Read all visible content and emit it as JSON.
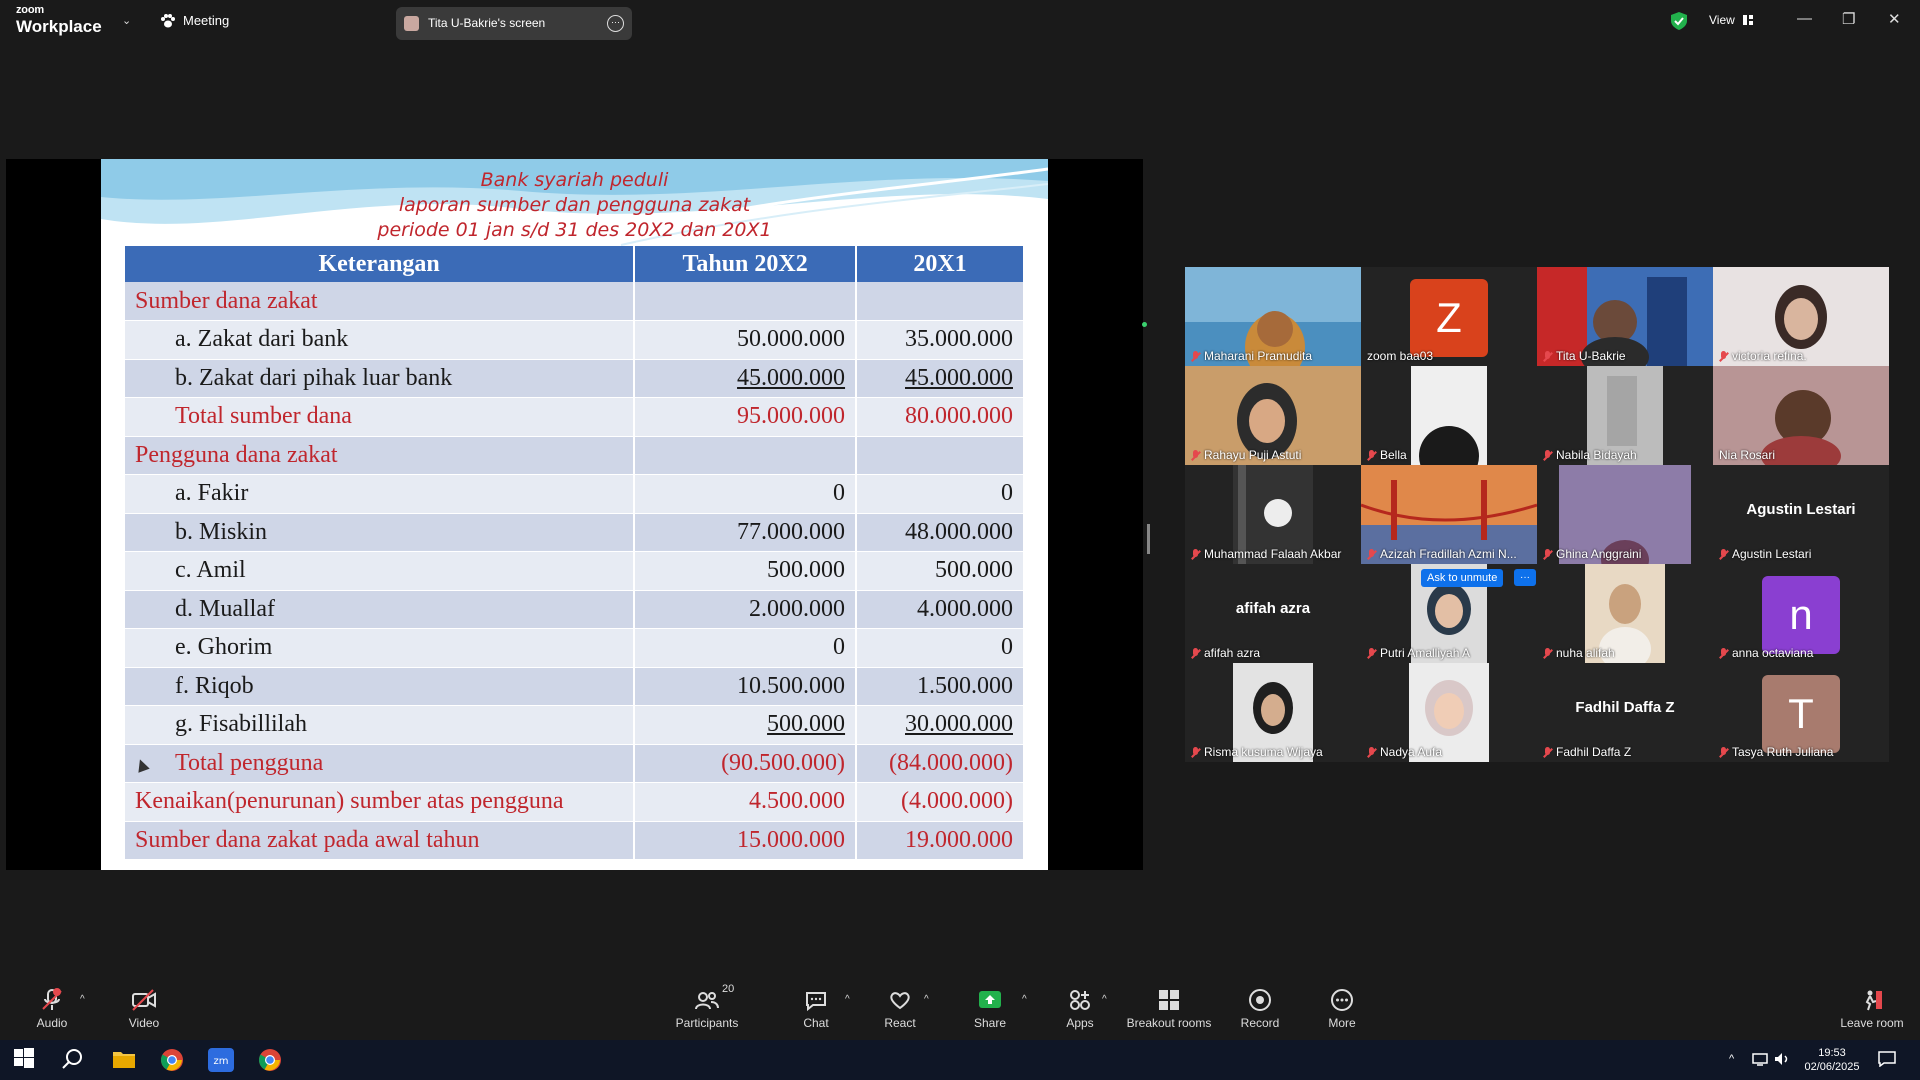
{
  "app": {
    "logo_line1": "zoom",
    "logo_line2": "Workplace",
    "meeting_label": "Meeting",
    "share_pill": "Tita U-Bakrie's screen",
    "view_label": "View"
  },
  "slide": {
    "title1": "Bank syariah peduli",
    "title2": "laporan sumber dan pengguna zakat",
    "title3": "periode 01 jan s/d 31 des 20X2 dan 20X1",
    "headers": [
      "Keterangan",
      "Tahun 20X2",
      "20X1"
    ],
    "rows": [
      {
        "label": "Sumber  dana zakat",
        "v1": "",
        "v2": ""
      },
      {
        "label": "a. Zakat dari bank",
        "v1": "50.000.000",
        "v2": "35.000.000"
      },
      {
        "label": "b. Zakat dari pihak luar bank",
        "v1": "45.000.000",
        "v2": "45.000.000"
      },
      {
        "label": "Total sumber dana",
        "v1": "95.000.000",
        "v2": "80.000.000"
      },
      {
        "label": "Pengguna dana zakat",
        "v1": "",
        "v2": ""
      },
      {
        "label": "a. Fakir",
        "v1": "0",
        "v2": "0"
      },
      {
        "label": "b. Miskin",
        "v1": "77.000.000",
        "v2": "48.000.000"
      },
      {
        "label": "c. Amil",
        "v1": "500.000",
        "v2": "500.000"
      },
      {
        "label": "d. Muallaf",
        "v1": "2.000.000",
        "v2": "4.000.000"
      },
      {
        "label": "e. Ghorim",
        "v1": "0",
        "v2": "0"
      },
      {
        "label": "f. Riqob",
        "v1": "10.500.000",
        "v2": "1.500.000"
      },
      {
        "label": "g. Fisabillilah",
        "v1": "500.000",
        "v2": "30.000.000"
      },
      {
        "label": "Total pengguna",
        "v1": "(90.500.000)",
        "v2": "(84.000.000)"
      },
      {
        "label": "Kenaikan(penurunan) sumber atas pengguna",
        "v1": "4.500.000",
        "v2": "(4.000.000)"
      },
      {
        "label": "Sumber dana zakat pada awal tahun",
        "v1": "15.000.000",
        "v2": "19.000.000"
      }
    ]
  },
  "gallery": {
    "ask_to_unmute": "Ask to unmute",
    "ask_more": "···",
    "participants": [
      {
        "name": "Maharani Pramudita"
      },
      {
        "name": "zoom baa03",
        "letter": "Z"
      },
      {
        "name": "Tita U-Bakrie"
      },
      {
        "name": "victoria refina."
      },
      {
        "name": "Rahayu Puji Astuti"
      },
      {
        "name": "Bella"
      },
      {
        "name": "Nabila Bidayah"
      },
      {
        "name": "Nia Rosari"
      },
      {
        "name": "Muhammad Falaah Akbar"
      },
      {
        "name": "Azizah Fradillah Azmi N..."
      },
      {
        "name": "Ghina Anggraini"
      },
      {
        "name": "Agustin Lestari",
        "big": "Agustin Lestari"
      },
      {
        "name": "afifah azra",
        "big": "afifah azra"
      },
      {
        "name": "Putri Amalliyah A"
      },
      {
        "name": "nuha alifah"
      },
      {
        "name": "anna octaviana",
        "letter": "n"
      },
      {
        "name": "Risma kusuma Wijaya"
      },
      {
        "name": "Nadya Aufa"
      },
      {
        "name": "Fadhil Daffa Z",
        "big": "Fadhil Daffa Z"
      },
      {
        "name": "Tasya Ruth Juliana",
        "letter": "T"
      }
    ]
  },
  "toolbar": {
    "audio": "Audio",
    "video": "Video",
    "participants": "Participants",
    "participants_count": "20",
    "chat": "Chat",
    "react": "React",
    "share": "Share",
    "apps": "Apps",
    "breakout": "Breakout rooms",
    "record": "Record",
    "more": "More",
    "leave": "Leave room"
  },
  "taskbar": {
    "time": "19:53",
    "date": "02/06/2025"
  },
  "colors": {
    "accent_red": "#c0262d",
    "table_header": "#3b6bb7",
    "share_green": "#3bd16f",
    "mute_red": "#e5484d"
  }
}
